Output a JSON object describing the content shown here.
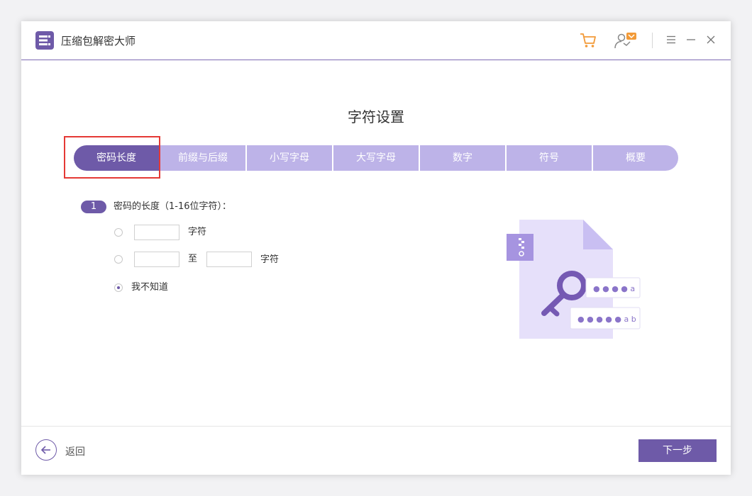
{
  "app": {
    "title": "压缩包解密大师"
  },
  "header": {
    "icons": [
      "cart-icon",
      "user-vip-icon",
      "menu-icon",
      "minimize-icon",
      "close-icon"
    ]
  },
  "page": {
    "title": "字符设置"
  },
  "tabs": [
    {
      "label": "密码长度",
      "active": true
    },
    {
      "label": "前缀与后缀"
    },
    {
      "label": "小写字母"
    },
    {
      "label": "大写字母"
    },
    {
      "label": "数字"
    },
    {
      "label": "符号"
    },
    {
      "label": "概要"
    }
  ],
  "step": {
    "number": "1",
    "label": "密码的长度（1-16位字符）：",
    "option1": {
      "value": "",
      "suffix": "字符"
    },
    "option2": {
      "from": "",
      "to_label": "至",
      "to": "",
      "suffix": "字符"
    },
    "option3": {
      "label": "我不知道",
      "checked": true
    }
  },
  "illustration": {
    "field1": "● ● ● ● a",
    "field2": "● ● ● ● ● a b"
  },
  "footer": {
    "back_label": "返回",
    "next_label": "下一步"
  },
  "colors": {
    "accent": "#6e5aa8",
    "tab_inactive": "#bdb3e8",
    "cart": "#f29a38",
    "highlight": "#e53935"
  }
}
